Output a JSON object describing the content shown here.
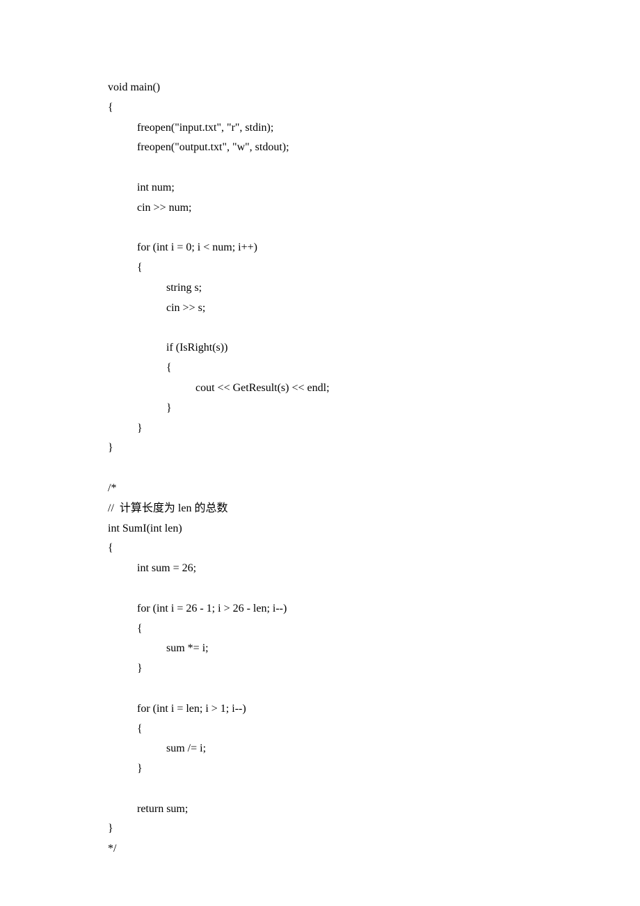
{
  "code": {
    "lines": [
      {
        "indent": 0,
        "text": "void main()"
      },
      {
        "indent": 0,
        "text": "{"
      },
      {
        "indent": 1,
        "text": "freopen(\"input.txt\", \"r\", stdin);"
      },
      {
        "indent": 1,
        "text": "freopen(\"output.txt\", \"w\", stdout);"
      },
      {
        "indent": 0,
        "text": ""
      },
      {
        "indent": 1,
        "text": "int num;"
      },
      {
        "indent": 1,
        "text": "cin >> num;"
      },
      {
        "indent": 0,
        "text": ""
      },
      {
        "indent": 1,
        "text": "for (int i = 0; i < num; i++)"
      },
      {
        "indent": 1,
        "text": "{"
      },
      {
        "indent": 2,
        "text": "string s;"
      },
      {
        "indent": 2,
        "text": "cin >> s;"
      },
      {
        "indent": 0,
        "text": ""
      },
      {
        "indent": 2,
        "text": "if (IsRight(s))"
      },
      {
        "indent": 2,
        "text": "{"
      },
      {
        "indent": 3,
        "text": "cout << GetResult(s) << endl;"
      },
      {
        "indent": 2,
        "text": "}"
      },
      {
        "indent": 1,
        "text": "}"
      },
      {
        "indent": 0,
        "text": "}"
      },
      {
        "indent": 0,
        "text": ""
      },
      {
        "indent": 0,
        "text": "/*"
      },
      {
        "indent": 0,
        "text": "//  计算长度为 len 的总数"
      },
      {
        "indent": 0,
        "text": "int SumI(int len)"
      },
      {
        "indent": 0,
        "text": "{"
      },
      {
        "indent": 1,
        "text": "int sum = 26;"
      },
      {
        "indent": 0,
        "text": ""
      },
      {
        "indent": 1,
        "text": "for (int i = 26 - 1; i > 26 - len; i--)"
      },
      {
        "indent": 1,
        "text": "{"
      },
      {
        "indent": 2,
        "text": "sum *= i;"
      },
      {
        "indent": 1,
        "text": "}"
      },
      {
        "indent": 0,
        "text": ""
      },
      {
        "indent": 1,
        "text": "for (int i = len; i > 1; i--)"
      },
      {
        "indent": 1,
        "text": "{"
      },
      {
        "indent": 2,
        "text": "sum /= i;"
      },
      {
        "indent": 1,
        "text": "}"
      },
      {
        "indent": 0,
        "text": ""
      },
      {
        "indent": 1,
        "text": "return sum;"
      },
      {
        "indent": 0,
        "text": "}"
      },
      {
        "indent": 0,
        "text": "*/"
      }
    ]
  }
}
